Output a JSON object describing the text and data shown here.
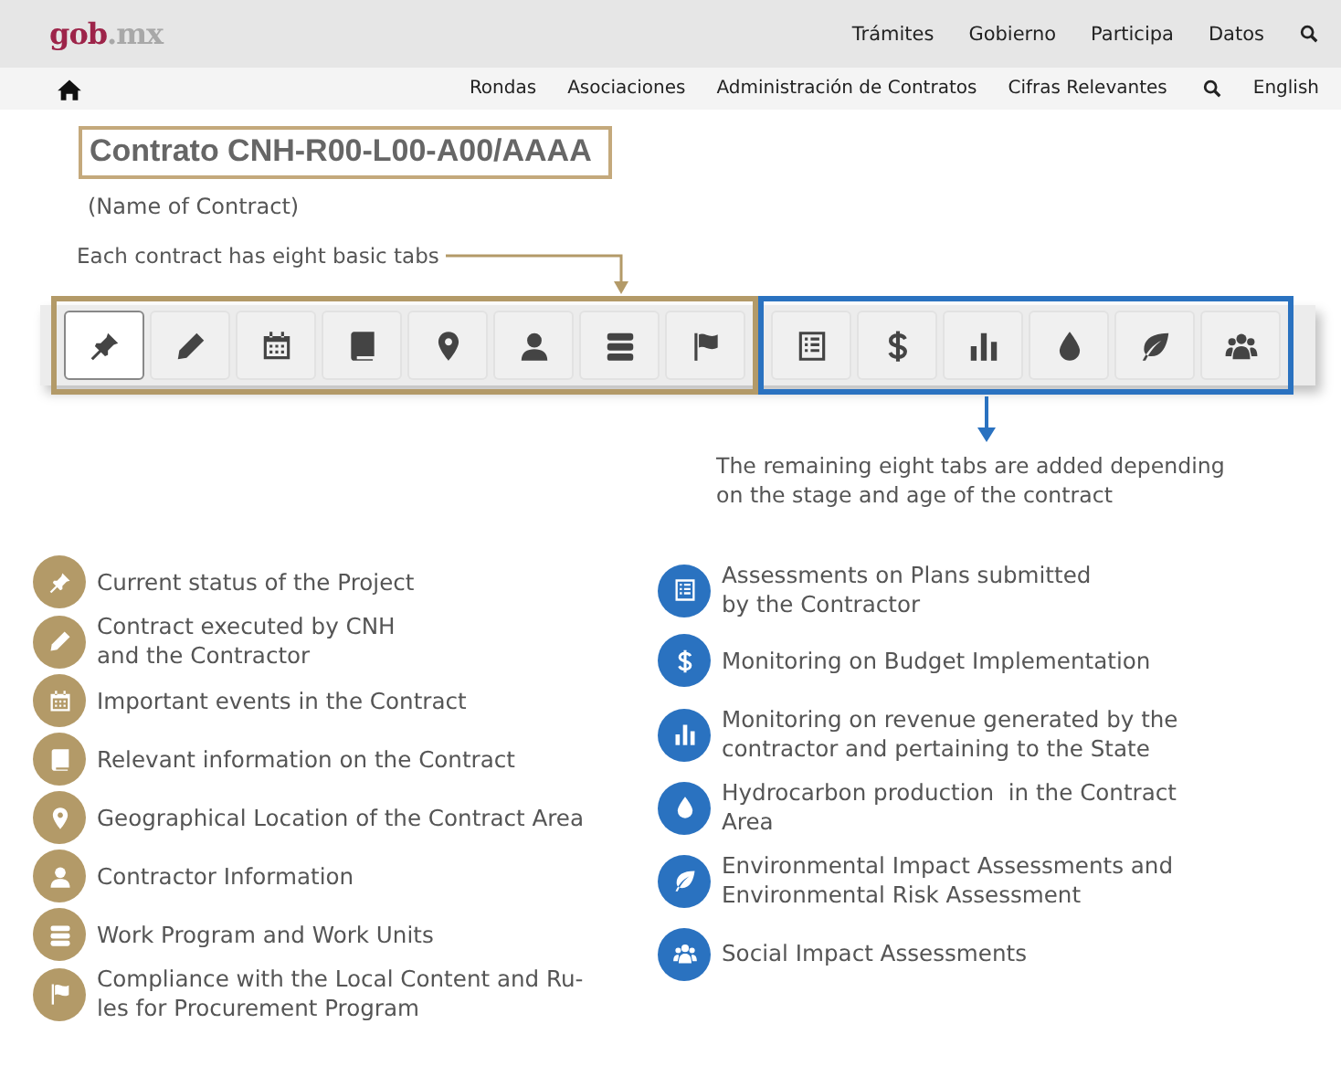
{
  "top_bar": {
    "logo": {
      "main": "gob",
      "suffix": ".mx"
    },
    "links": [
      "Trámites",
      "Gobierno",
      "Participa",
      "Datos"
    ]
  },
  "nav_bar": {
    "links": [
      "Rondas",
      "Asociaciones",
      "Administración de Contratos",
      "Cifras Relevantes"
    ],
    "language": "English"
  },
  "title": "Contrato CNH-R00-L00-A00/AAAA",
  "subtitle": "(Name of Contract)",
  "basic_note": "Each contract has eight basic tabs",
  "extra_note": "The remaining eight tabs are added depending\non the stage and age of the contract",
  "tab_groups": [
    {
      "color": "#b39a68",
      "tabs": [
        {
          "kind": "pin",
          "selected": true
        },
        {
          "kind": "pencil",
          "selected": false
        },
        {
          "kind": "calendar",
          "selected": false
        },
        {
          "kind": "book",
          "selected": false
        },
        {
          "kind": "marker",
          "selected": false
        },
        {
          "kind": "person",
          "selected": false
        },
        {
          "kind": "stack",
          "selected": false
        },
        {
          "kind": "flag",
          "selected": false
        }
      ]
    },
    {
      "color": "#2a72c0",
      "tabs": [
        {
          "kind": "list",
          "selected": false
        },
        {
          "kind": "dollar",
          "selected": false
        },
        {
          "kind": "bars",
          "selected": false
        },
        {
          "kind": "drop",
          "selected": false
        },
        {
          "kind": "leaf",
          "selected": false
        },
        {
          "kind": "group",
          "selected": false
        }
      ]
    }
  ],
  "legend_columns": [
    {
      "color": "#b39a68",
      "items": [
        {
          "kind": "pin",
          "text": "Current status of the Project"
        },
        {
          "kind": "pencil",
          "text": "Contract executed by CNH\nand the Contractor"
        },
        {
          "kind": "calendar",
          "text": "Important events in the Contract"
        },
        {
          "kind": "book",
          "text": "Relevant information on the Contract"
        },
        {
          "kind": "marker",
          "text": "Geographical Location of the Contract Area"
        },
        {
          "kind": "person",
          "text": "Contractor Information"
        },
        {
          "kind": "stack",
          "text": "Work Program and Work Units"
        },
        {
          "kind": "flag",
          "text": "Compliance with the Local Content and Ru-\nles for Procurement Program"
        }
      ]
    },
    {
      "color": "#2a72c0",
      "items": [
        {
          "kind": "list",
          "text": "Assessments on Plans submitted\nby the Contractor"
        },
        {
          "kind": "dollar",
          "text": "Monitoring on Budget Implementation"
        },
        {
          "kind": "bars",
          "text": "Monitoring on revenue generated by the\ncontractor and pertaining to the State"
        },
        {
          "kind": "drop",
          "text": "Hydrocarbon production  in the Contract\nArea"
        },
        {
          "kind": "leaf",
          "text": "Environmental Impact Assessments and\nEnvironmental Risk Assessment"
        },
        {
          "kind": "group",
          "text": "Social Impact Assessments"
        }
      ]
    }
  ]
}
